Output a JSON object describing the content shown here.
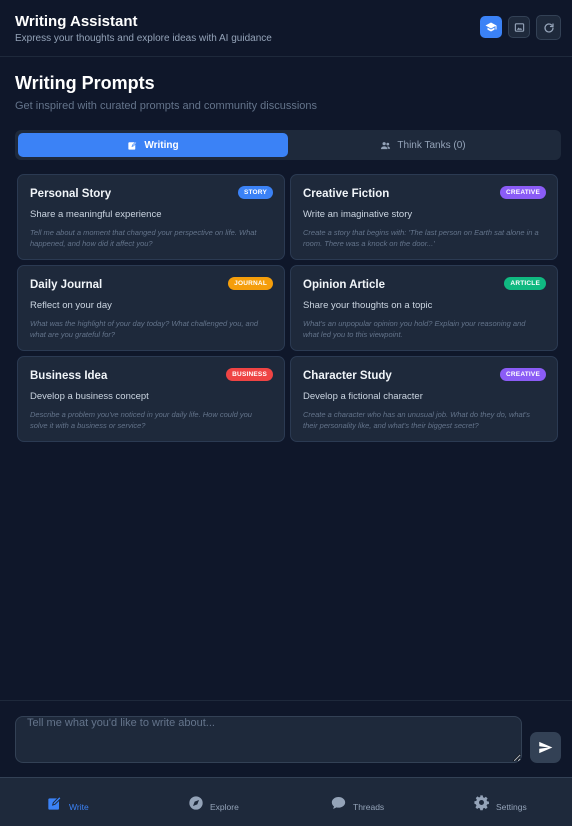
{
  "header": {
    "title": "Writing Assistant",
    "subtitle": "Express your thoughts and explore ideas with AI guidance",
    "buttons": [
      {
        "icon": "graduation-cap-icon",
        "active": true
      },
      {
        "icon": "image-icon",
        "active": false
      },
      {
        "icon": "refresh-icon",
        "active": false
      }
    ]
  },
  "section": {
    "title": "Writing Prompts",
    "subtitle": "Get inspired with curated prompts and community discussions"
  },
  "tabs": [
    {
      "label": "Writing",
      "icon": "edit-icon",
      "active": true
    },
    {
      "label": "Think Tanks (0)",
      "icon": "users-icon",
      "active": false
    }
  ],
  "prompts": [
    {
      "title": "Personal Story",
      "badge": "STORY",
      "badge_color": "#3b82f6",
      "description": "Share a meaningful experience",
      "prompt": "Tell me about a moment that changed your perspective on life. What happened, and how did it affect you?"
    },
    {
      "title": "Creative Fiction",
      "badge": "CREATIVE",
      "badge_color": "#8b5cf6",
      "description": "Write an imaginative story",
      "prompt": "Create a story that begins with: 'The last person on Earth sat alone in a room. There was a knock on the door...'"
    },
    {
      "title": "Daily Journal",
      "badge": "JOURNAL",
      "badge_color": "#f59e0b",
      "description": "Reflect on your day",
      "prompt": "What was the highlight of your day today? What challenged you, and what are you grateful for?"
    },
    {
      "title": "Opinion Article",
      "badge": "ARTICLE",
      "badge_color": "#10b981",
      "description": "Share your thoughts on a topic",
      "prompt": "What's an unpopular opinion you hold? Explain your reasoning and what led you to this viewpoint."
    },
    {
      "title": "Business Idea",
      "badge": "BUSINESS",
      "badge_color": "#ef4444",
      "description": "Develop a business concept",
      "prompt": "Describe a problem you've noticed in your daily life. How could you solve it with a business or service?"
    },
    {
      "title": "Character Study",
      "badge": "CREATIVE",
      "badge_color": "#8b5cf6",
      "description": "Develop a fictional character",
      "prompt": "Create a character who has an unusual job. What do they do, what's their personality like, and what's their biggest secret?"
    }
  ],
  "composer": {
    "placeholder": "Tell me what you'd like to write about...",
    "send_icon": "send-icon"
  },
  "nav": [
    {
      "label": "Write",
      "icon": "edit-icon",
      "active": true
    },
    {
      "label": "Explore",
      "icon": "compass-icon",
      "active": false
    },
    {
      "label": "Threads",
      "icon": "chat-icon",
      "active": false
    },
    {
      "label": "Settings",
      "icon": "gear-icon",
      "active": false
    }
  ],
  "colors": {
    "background": "#0f172a",
    "surface": "#1e293b",
    "accent": "#3b82f6",
    "muted_text": "#64748b"
  }
}
